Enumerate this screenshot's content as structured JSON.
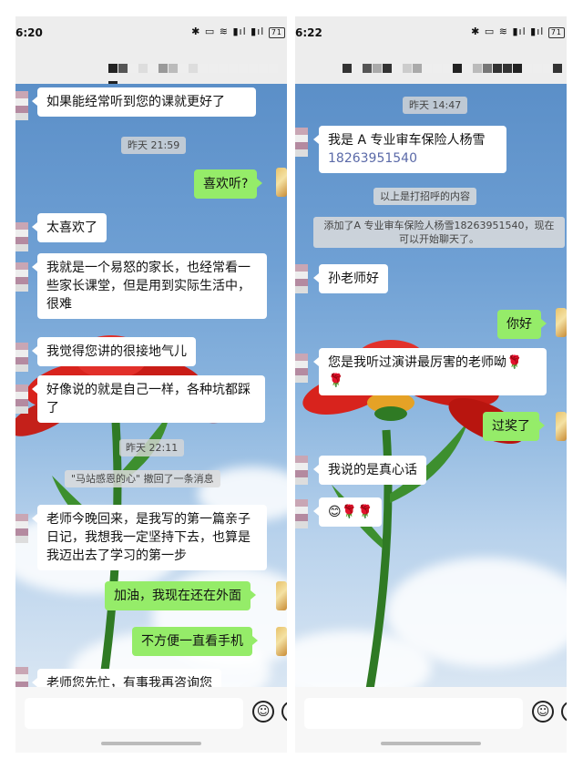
{
  "left": {
    "status_time": "6:20",
    "status_icons": "✱ ▭ ≋ ▮ıl ▮ıl",
    "battery": "71",
    "messages": [
      {
        "type": "in",
        "text": "如果能经常听到您的课就更好了"
      },
      {
        "type": "time",
        "text": "昨天 21:59"
      },
      {
        "type": "out",
        "text": "喜欢听?"
      },
      {
        "type": "in",
        "text": "太喜欢了"
      },
      {
        "type": "in",
        "text": "我就是一个易怒的家长，也经常看一些家长课堂，但是用到实际生活中，很难"
      },
      {
        "type": "in",
        "text": "我觉得您讲的很接地气儿"
      },
      {
        "type": "in",
        "text": "好像说的就是自己一样，各种坑都踩了"
      },
      {
        "type": "time",
        "text": "昨天 22:11"
      },
      {
        "type": "sys",
        "text": "\"马站感恩的心\" 撤回了一条消息"
      },
      {
        "type": "in",
        "text": "老师今晚回来，是我写的第一篇亲子日记，我想我一定坚持下去，也算是我迈出去了学习的第一步"
      },
      {
        "type": "out",
        "text": "加油，我现在还在外面"
      },
      {
        "type": "out",
        "text": "不方便一直看手机"
      },
      {
        "type": "in",
        "text": "老师您先忙，有事我再咨询您"
      }
    ]
  },
  "right": {
    "status_time": "6:22",
    "status_icons": "✱ ▭ ≋ ▮ıl ▮ıl",
    "battery": "71",
    "messages": [
      {
        "type": "time",
        "text": "昨天 14:47"
      },
      {
        "type": "in",
        "text": "我是 A 专业审车保险人杨雪",
        "phone": "18263951540"
      },
      {
        "type": "sys",
        "text": "以上是打招呼的内容"
      },
      {
        "type": "sys",
        "text": "添加了A 专业审车保险人杨雪18263951540，现在可以开始聊天了。"
      },
      {
        "type": "in",
        "text": "孙老师好"
      },
      {
        "type": "out",
        "text": "你好"
      },
      {
        "type": "in",
        "text": "您是我听过演讲最厉害的老师呦🌹🌹"
      },
      {
        "type": "out",
        "text": "过奖了"
      },
      {
        "type": "in",
        "text": "我说的是真心话"
      },
      {
        "type": "in",
        "text": "😊🌹🌹"
      }
    ]
  },
  "icons": {
    "emoji_button": "emoji-face-icon",
    "more_button": "plus-icon"
  },
  "colors": {
    "incoming_bubble": "#ffffff",
    "outgoing_bubble": "#95ec69",
    "chat_background_sky": "#6fa0d4",
    "flower_petal": "#d8231d",
    "phone_link": "#5b6aa8"
  }
}
